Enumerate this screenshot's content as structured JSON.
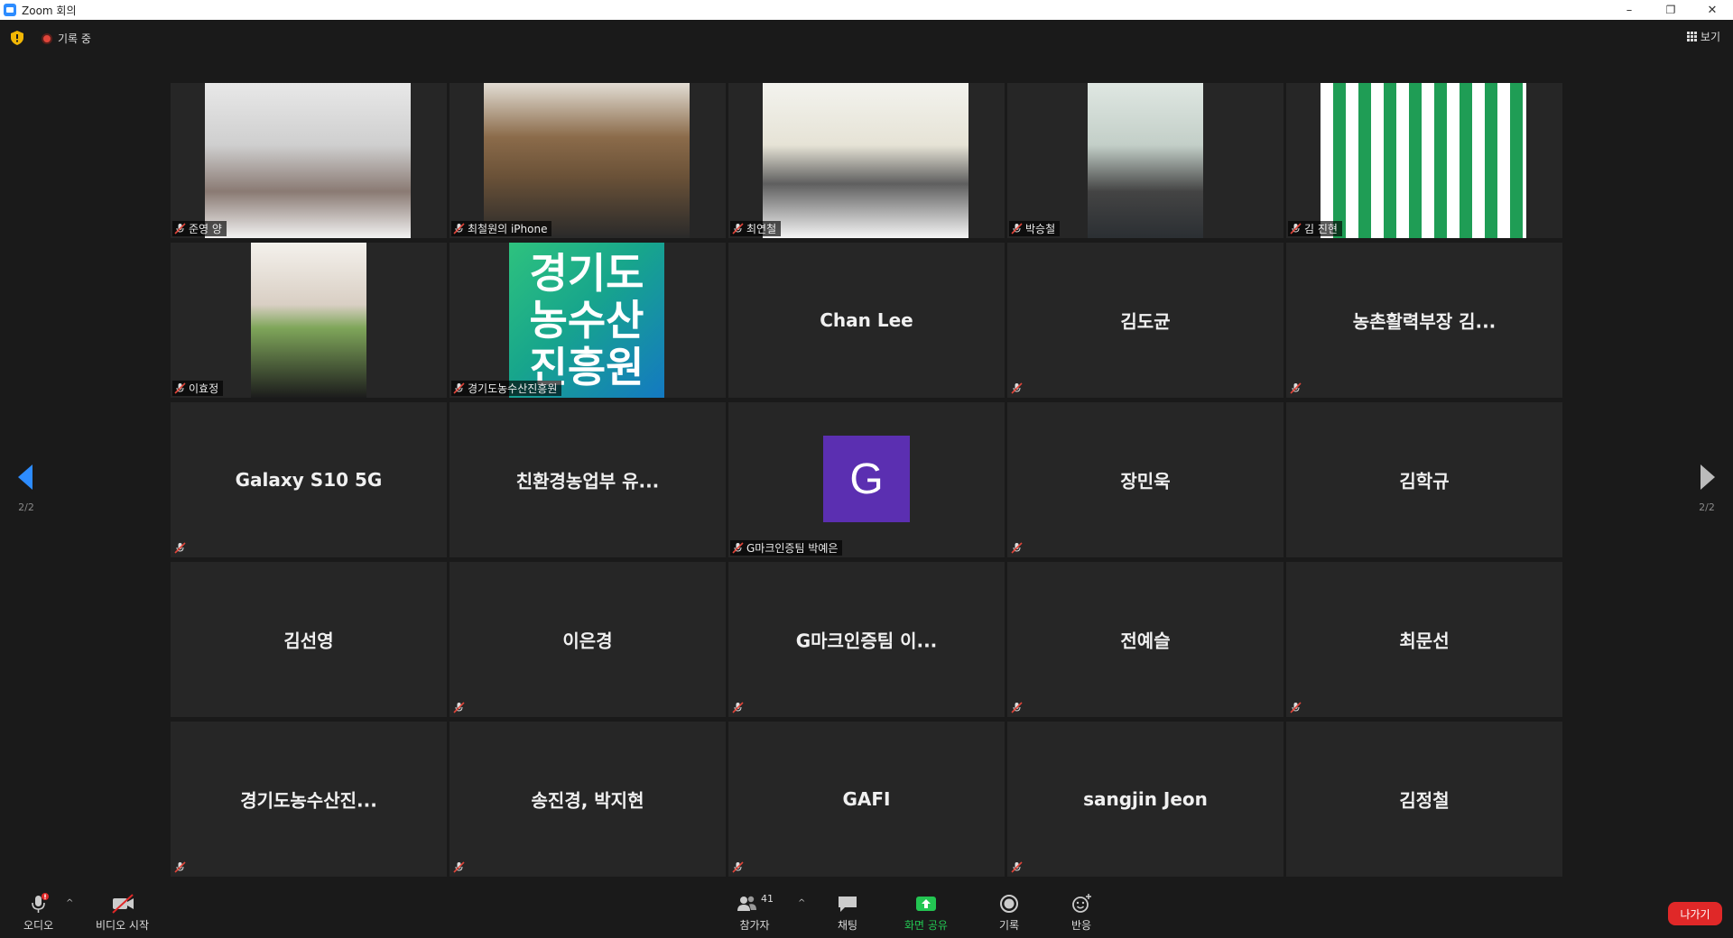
{
  "window": {
    "title": "Zoom 회의",
    "minimize": "–",
    "restore": "❐",
    "close": "✕"
  },
  "topbar": {
    "recording_label": "기록 중",
    "view_label": "보기"
  },
  "pager": {
    "left": "2/2",
    "right": "2/2"
  },
  "tiles": [
    {
      "name": "준영 양",
      "video": true,
      "muted": true
    },
    {
      "name": "최철원의 iPhone",
      "video": true,
      "muted": true
    },
    {
      "name": "최연철",
      "video": true,
      "muted": true
    },
    {
      "name": "박승철",
      "video": true,
      "muted": true
    },
    {
      "name": "김 진현",
      "video": true,
      "muted": true
    },
    {
      "name": "이효정",
      "video": true,
      "muted": true
    },
    {
      "name": "경기도농수산진흥원",
      "video": true,
      "muted": true,
      "logo_text": [
        "경기도",
        "농수산",
        "진흥원"
      ]
    },
    {
      "display": "Chan Lee"
    },
    {
      "display": "김도균",
      "muted": true
    },
    {
      "display": "농촌활력부장 김...",
      "muted": true
    },
    {
      "display": "Galaxy S10 5G",
      "muted": true
    },
    {
      "display": "친환경농업부 유..."
    },
    {
      "name": "G마크인증팀 박예은",
      "avatar": "G",
      "muted": true
    },
    {
      "display": "장민욱",
      "muted": true
    },
    {
      "display": "김학규"
    },
    {
      "display": "김선영"
    },
    {
      "display": "이은경",
      "muted": true
    },
    {
      "display": "G마크인증팀 이...",
      "muted": true
    },
    {
      "display": "전예슬",
      "muted": true
    },
    {
      "display": "최문선",
      "muted": true
    },
    {
      "display": "경기도농수산진...",
      "muted": true
    },
    {
      "display": "송진경, 박지현",
      "muted": true
    },
    {
      "display": "GAFI",
      "muted": true
    },
    {
      "display": "sangjin Jeon",
      "muted": true
    },
    {
      "display": "김정철"
    }
  ],
  "toolbar": {
    "audio": "오디오",
    "video": "비디오 시작",
    "participants": "참가자",
    "participants_count": "41",
    "chat": "채팅",
    "share": "화면 공유",
    "record": "기록",
    "reactions": "반응",
    "leave": "나가기",
    "caret": "^"
  },
  "colors": {
    "share_green": "#23c552",
    "leave_red": "#e02828",
    "arrow_blue": "#2d8cff",
    "avatar_purple": "#5b2fb1"
  }
}
